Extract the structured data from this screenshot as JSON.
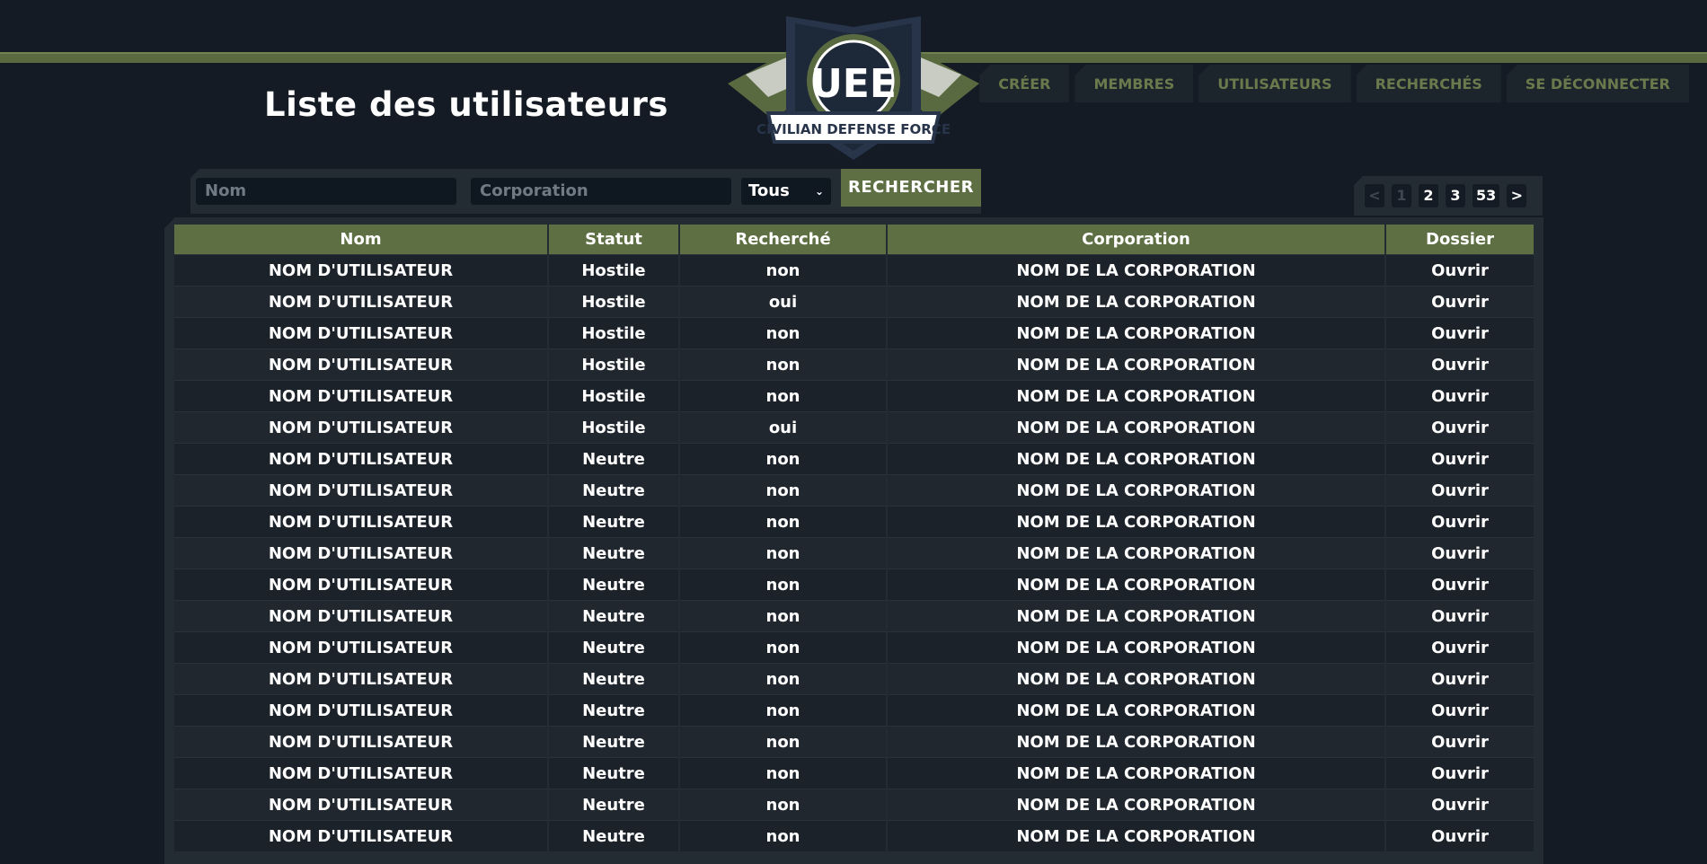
{
  "page": {
    "title": "Liste des utilisateurs"
  },
  "logo": {
    "letters": "UEE",
    "text": "CIVILIAN DEFENSE FORCE"
  },
  "nav": [
    "CRÉER",
    "MEMBRES",
    "UTILISATEURS",
    "RECHERCHÉS",
    "SE DÉCONNECTER"
  ],
  "search": {
    "name_placeholder": "Nom",
    "corp_placeholder": "Corporation",
    "filter_value": "Tous",
    "button": "RECHERCHER"
  },
  "pagination": [
    "<",
    "1",
    "2",
    "3",
    "53",
    ">"
  ],
  "colors": {
    "accent": "#5e6f44",
    "nav_text": "#6b7a4c",
    "background": "#141b24"
  },
  "table": {
    "headers": [
      "Nom",
      "Statut",
      "Recherché",
      "Corporation",
      "Dossier"
    ],
    "rows": [
      [
        "NOM D'UTILISATEUR",
        "Hostile",
        "non",
        "NOM DE LA CORPORATION",
        "Ouvrir"
      ],
      [
        "NOM D'UTILISATEUR",
        "Hostile",
        "oui",
        "NOM DE LA CORPORATION",
        "Ouvrir"
      ],
      [
        "NOM D'UTILISATEUR",
        "Hostile",
        "non",
        "NOM DE LA CORPORATION",
        "Ouvrir"
      ],
      [
        "NOM D'UTILISATEUR",
        "Hostile",
        "non",
        "NOM DE LA CORPORATION",
        "Ouvrir"
      ],
      [
        "NOM D'UTILISATEUR",
        "Hostile",
        "non",
        "NOM DE LA CORPORATION",
        "Ouvrir"
      ],
      [
        "NOM D'UTILISATEUR",
        "Hostile",
        "oui",
        "NOM DE LA CORPORATION",
        "Ouvrir"
      ],
      [
        "NOM D'UTILISATEUR",
        "Neutre",
        "non",
        "NOM DE LA CORPORATION",
        "Ouvrir"
      ],
      [
        "NOM D'UTILISATEUR",
        "Neutre",
        "non",
        "NOM DE LA CORPORATION",
        "Ouvrir"
      ],
      [
        "NOM D'UTILISATEUR",
        "Neutre",
        "non",
        "NOM DE LA CORPORATION",
        "Ouvrir"
      ],
      [
        "NOM D'UTILISATEUR",
        "Neutre",
        "non",
        "NOM DE LA CORPORATION",
        "Ouvrir"
      ],
      [
        "NOM D'UTILISATEUR",
        "Neutre",
        "non",
        "NOM DE LA CORPORATION",
        "Ouvrir"
      ],
      [
        "NOM D'UTILISATEUR",
        "Neutre",
        "non",
        "NOM DE LA CORPORATION",
        "Ouvrir"
      ],
      [
        "NOM D'UTILISATEUR",
        "Neutre",
        "non",
        "NOM DE LA CORPORATION",
        "Ouvrir"
      ],
      [
        "NOM D'UTILISATEUR",
        "Neutre",
        "non",
        "NOM DE LA CORPORATION",
        "Ouvrir"
      ],
      [
        "NOM D'UTILISATEUR",
        "Neutre",
        "non",
        "NOM DE LA CORPORATION",
        "Ouvrir"
      ],
      [
        "NOM D'UTILISATEUR",
        "Neutre",
        "non",
        "NOM DE LA CORPORATION",
        "Ouvrir"
      ],
      [
        "NOM D'UTILISATEUR",
        "Neutre",
        "non",
        "NOM DE LA CORPORATION",
        "Ouvrir"
      ],
      [
        "NOM D'UTILISATEUR",
        "Neutre",
        "non",
        "NOM DE LA CORPORATION",
        "Ouvrir"
      ],
      [
        "NOM D'UTILISATEUR",
        "Neutre",
        "non",
        "NOM DE LA CORPORATION",
        "Ouvrir"
      ]
    ]
  }
}
